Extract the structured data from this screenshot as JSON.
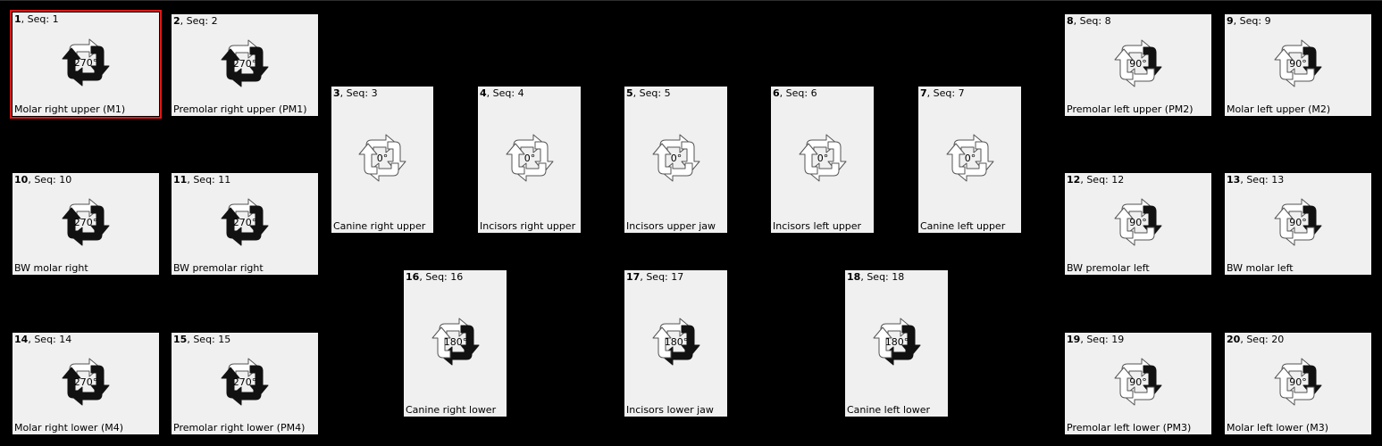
{
  "tiles": [
    {
      "num": "1",
      "seq": "Seq: 1",
      "label": "Molar right upper (M1)",
      "rotation": "270°",
      "active": [
        1,
        2,
        3
      ],
      "selected": true
    },
    {
      "num": "2",
      "seq": "Seq: 2",
      "label": "Premolar right upper (PM1)",
      "rotation": "270°",
      "active": [
        1,
        2,
        3
      ],
      "selected": false
    },
    {
      "num": "3",
      "seq": "Seq: 3",
      "label": "Canine right upper",
      "rotation": "0°",
      "active": [],
      "selected": false
    },
    {
      "num": "4",
      "seq": "Seq: 4",
      "label": "Incisors right upper",
      "rotation": "0°",
      "active": [],
      "selected": false
    },
    {
      "num": "5",
      "seq": "Seq: 5",
      "label": "Incisors upper jaw",
      "rotation": "0°",
      "active": [],
      "selected": false
    },
    {
      "num": "6",
      "seq": "Seq: 6",
      "label": "Incisors left upper",
      "rotation": "0°",
      "active": [],
      "selected": false
    },
    {
      "num": "7",
      "seq": "Seq: 7",
      "label": "Canine left upper",
      "rotation": "0°",
      "active": [],
      "selected": false
    },
    {
      "num": "8",
      "seq": "Seq: 8",
      "label": "Premolar left upper (PM2)",
      "rotation": "90°",
      "active": [
        1
      ],
      "selected": false
    },
    {
      "num": "9",
      "seq": "Seq: 9",
      "label": "Molar left upper (M2)",
      "rotation": "90°",
      "active": [
        1
      ],
      "selected": false
    },
    {
      "num": "10",
      "seq": "Seq: 10",
      "label": "BW molar right",
      "rotation": "270°",
      "active": [
        1,
        2,
        3
      ],
      "selected": false
    },
    {
      "num": "11",
      "seq": "Seq: 11",
      "label": "BW premolar right",
      "rotation": "270°",
      "active": [
        1,
        2,
        3
      ],
      "selected": false
    },
    {
      "num": "12",
      "seq": "Seq: 12",
      "label": "BW premolar left",
      "rotation": "90°",
      "active": [
        1
      ],
      "selected": false
    },
    {
      "num": "13",
      "seq": "Seq: 13",
      "label": "BW molar left",
      "rotation": "90°",
      "active": [
        1
      ],
      "selected": false
    },
    {
      "num": "14",
      "seq": "Seq: 14",
      "label": "Molar right lower (M4)",
      "rotation": "270°",
      "active": [
        1,
        2,
        3
      ],
      "selected": false
    },
    {
      "num": "15",
      "seq": "Seq: 15",
      "label": "Premolar right lower (PM4)",
      "rotation": "270°",
      "active": [
        1,
        2,
        3
      ],
      "selected": false
    },
    {
      "num": "16",
      "seq": "Seq: 16",
      "label": "Canine right lower",
      "rotation": "180°",
      "active": [
        1,
        2
      ],
      "selected": false
    },
    {
      "num": "17",
      "seq": "Seq: 17",
      "label": "Incisors lower jaw",
      "rotation": "180°",
      "active": [
        1,
        2
      ],
      "selected": false
    },
    {
      "num": "18",
      "seq": "Seq: 18",
      "label": "Canine left lower",
      "rotation": "180°",
      "active": [
        1,
        2
      ],
      "selected": false
    },
    {
      "num": "19",
      "seq": "Seq: 19",
      "label": "Premolar left lower (PM3)",
      "rotation": "90°",
      "active": [
        1
      ],
      "selected": false
    },
    {
      "num": "20",
      "seq": "Seq: 20",
      "label": "Molar left lower (M3)",
      "rotation": "90°",
      "active": [
        1
      ],
      "selected": false
    }
  ]
}
